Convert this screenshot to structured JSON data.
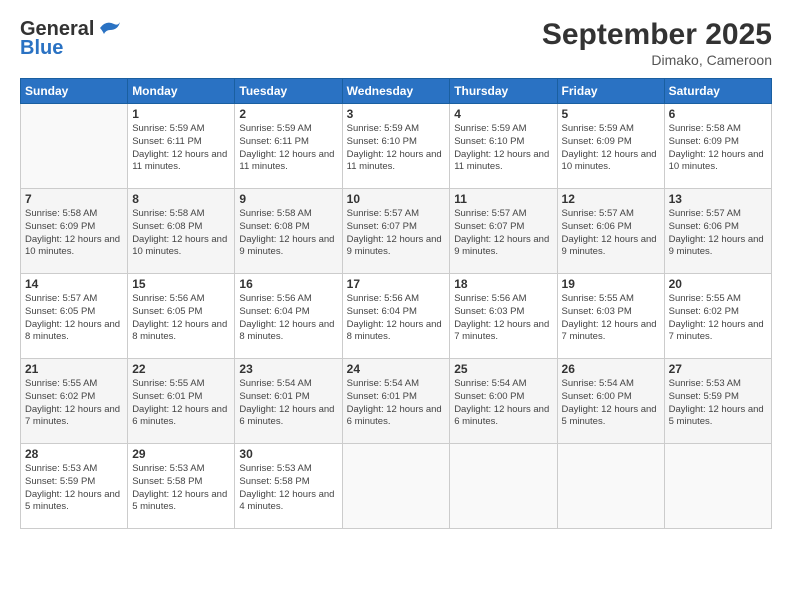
{
  "header": {
    "logo": {
      "line1": "General",
      "line2": "Blue"
    },
    "title": "September 2025",
    "location": "Dimako, Cameroon"
  },
  "days_of_week": [
    "Sunday",
    "Monday",
    "Tuesday",
    "Wednesday",
    "Thursday",
    "Friday",
    "Saturday"
  ],
  "weeks": [
    [
      {
        "num": "",
        "sunrise": "",
        "sunset": "",
        "daylight": ""
      },
      {
        "num": "1",
        "sunrise": "Sunrise: 5:59 AM",
        "sunset": "Sunset: 6:11 PM",
        "daylight": "Daylight: 12 hours and 11 minutes."
      },
      {
        "num": "2",
        "sunrise": "Sunrise: 5:59 AM",
        "sunset": "Sunset: 6:11 PM",
        "daylight": "Daylight: 12 hours and 11 minutes."
      },
      {
        "num": "3",
        "sunrise": "Sunrise: 5:59 AM",
        "sunset": "Sunset: 6:10 PM",
        "daylight": "Daylight: 12 hours and 11 minutes."
      },
      {
        "num": "4",
        "sunrise": "Sunrise: 5:59 AM",
        "sunset": "Sunset: 6:10 PM",
        "daylight": "Daylight: 12 hours and 11 minutes."
      },
      {
        "num": "5",
        "sunrise": "Sunrise: 5:59 AM",
        "sunset": "Sunset: 6:09 PM",
        "daylight": "Daylight: 12 hours and 10 minutes."
      },
      {
        "num": "6",
        "sunrise": "Sunrise: 5:58 AM",
        "sunset": "Sunset: 6:09 PM",
        "daylight": "Daylight: 12 hours and 10 minutes."
      }
    ],
    [
      {
        "num": "7",
        "sunrise": "Sunrise: 5:58 AM",
        "sunset": "Sunset: 6:09 PM",
        "daylight": "Daylight: 12 hours and 10 minutes."
      },
      {
        "num": "8",
        "sunrise": "Sunrise: 5:58 AM",
        "sunset": "Sunset: 6:08 PM",
        "daylight": "Daylight: 12 hours and 10 minutes."
      },
      {
        "num": "9",
        "sunrise": "Sunrise: 5:58 AM",
        "sunset": "Sunset: 6:08 PM",
        "daylight": "Daylight: 12 hours and 9 minutes."
      },
      {
        "num": "10",
        "sunrise": "Sunrise: 5:57 AM",
        "sunset": "Sunset: 6:07 PM",
        "daylight": "Daylight: 12 hours and 9 minutes."
      },
      {
        "num": "11",
        "sunrise": "Sunrise: 5:57 AM",
        "sunset": "Sunset: 6:07 PM",
        "daylight": "Daylight: 12 hours and 9 minutes."
      },
      {
        "num": "12",
        "sunrise": "Sunrise: 5:57 AM",
        "sunset": "Sunset: 6:06 PM",
        "daylight": "Daylight: 12 hours and 9 minutes."
      },
      {
        "num": "13",
        "sunrise": "Sunrise: 5:57 AM",
        "sunset": "Sunset: 6:06 PM",
        "daylight": "Daylight: 12 hours and 9 minutes."
      }
    ],
    [
      {
        "num": "14",
        "sunrise": "Sunrise: 5:57 AM",
        "sunset": "Sunset: 6:05 PM",
        "daylight": "Daylight: 12 hours and 8 minutes."
      },
      {
        "num": "15",
        "sunrise": "Sunrise: 5:56 AM",
        "sunset": "Sunset: 6:05 PM",
        "daylight": "Daylight: 12 hours and 8 minutes."
      },
      {
        "num": "16",
        "sunrise": "Sunrise: 5:56 AM",
        "sunset": "Sunset: 6:04 PM",
        "daylight": "Daylight: 12 hours and 8 minutes."
      },
      {
        "num": "17",
        "sunrise": "Sunrise: 5:56 AM",
        "sunset": "Sunset: 6:04 PM",
        "daylight": "Daylight: 12 hours and 8 minutes."
      },
      {
        "num": "18",
        "sunrise": "Sunrise: 5:56 AM",
        "sunset": "Sunset: 6:03 PM",
        "daylight": "Daylight: 12 hours and 7 minutes."
      },
      {
        "num": "19",
        "sunrise": "Sunrise: 5:55 AM",
        "sunset": "Sunset: 6:03 PM",
        "daylight": "Daylight: 12 hours and 7 minutes."
      },
      {
        "num": "20",
        "sunrise": "Sunrise: 5:55 AM",
        "sunset": "Sunset: 6:02 PM",
        "daylight": "Daylight: 12 hours and 7 minutes."
      }
    ],
    [
      {
        "num": "21",
        "sunrise": "Sunrise: 5:55 AM",
        "sunset": "Sunset: 6:02 PM",
        "daylight": "Daylight: 12 hours and 7 minutes."
      },
      {
        "num": "22",
        "sunrise": "Sunrise: 5:55 AM",
        "sunset": "Sunset: 6:01 PM",
        "daylight": "Daylight: 12 hours and 6 minutes."
      },
      {
        "num": "23",
        "sunrise": "Sunrise: 5:54 AM",
        "sunset": "Sunset: 6:01 PM",
        "daylight": "Daylight: 12 hours and 6 minutes."
      },
      {
        "num": "24",
        "sunrise": "Sunrise: 5:54 AM",
        "sunset": "Sunset: 6:01 PM",
        "daylight": "Daylight: 12 hours and 6 minutes."
      },
      {
        "num": "25",
        "sunrise": "Sunrise: 5:54 AM",
        "sunset": "Sunset: 6:00 PM",
        "daylight": "Daylight: 12 hours and 6 minutes."
      },
      {
        "num": "26",
        "sunrise": "Sunrise: 5:54 AM",
        "sunset": "Sunset: 6:00 PM",
        "daylight": "Daylight: 12 hours and 5 minutes."
      },
      {
        "num": "27",
        "sunrise": "Sunrise: 5:53 AM",
        "sunset": "Sunset: 5:59 PM",
        "daylight": "Daylight: 12 hours and 5 minutes."
      }
    ],
    [
      {
        "num": "28",
        "sunrise": "Sunrise: 5:53 AM",
        "sunset": "Sunset: 5:59 PM",
        "daylight": "Daylight: 12 hours and 5 minutes."
      },
      {
        "num": "29",
        "sunrise": "Sunrise: 5:53 AM",
        "sunset": "Sunset: 5:58 PM",
        "daylight": "Daylight: 12 hours and 5 minutes."
      },
      {
        "num": "30",
        "sunrise": "Sunrise: 5:53 AM",
        "sunset": "Sunset: 5:58 PM",
        "daylight": "Daylight: 12 hours and 4 minutes."
      },
      {
        "num": "",
        "sunrise": "",
        "sunset": "",
        "daylight": ""
      },
      {
        "num": "",
        "sunrise": "",
        "sunset": "",
        "daylight": ""
      },
      {
        "num": "",
        "sunrise": "",
        "sunset": "",
        "daylight": ""
      },
      {
        "num": "",
        "sunrise": "",
        "sunset": "",
        "daylight": ""
      }
    ]
  ]
}
